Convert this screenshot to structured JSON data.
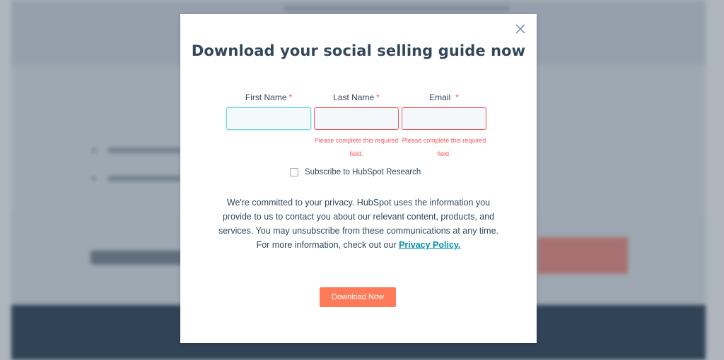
{
  "modal": {
    "title": "Download your social selling guide now",
    "close_icon": "close-icon",
    "fields": [
      {
        "label": "First Name",
        "required_mark": "*",
        "value": "",
        "state": "focused"
      },
      {
        "label": "Last Name",
        "required_mark": "*",
        "value": "",
        "state": "invalid",
        "error": "Please complete this required field."
      },
      {
        "label": "Email",
        "required_mark": "*",
        "value": "",
        "state": "invalid",
        "error": "Please complete this required field."
      }
    ],
    "subscribe": {
      "label": "Subscribe to HubSpot Research",
      "checked": false
    },
    "privacy": {
      "text": "We're committed to your privacy. HubSpot uses the information you provide to us to contact you about our relevant content, products, and services. You may unsubscribe from these communications at any time. For more information, check out our ",
      "link_text": "Privacy Policy."
    },
    "submit_label": "Download Now"
  },
  "colors": {
    "accent": "#ff7a59",
    "error": "#f2545b",
    "text": "#33475b",
    "link": "#0091ae",
    "focus": "#7fd1de"
  }
}
